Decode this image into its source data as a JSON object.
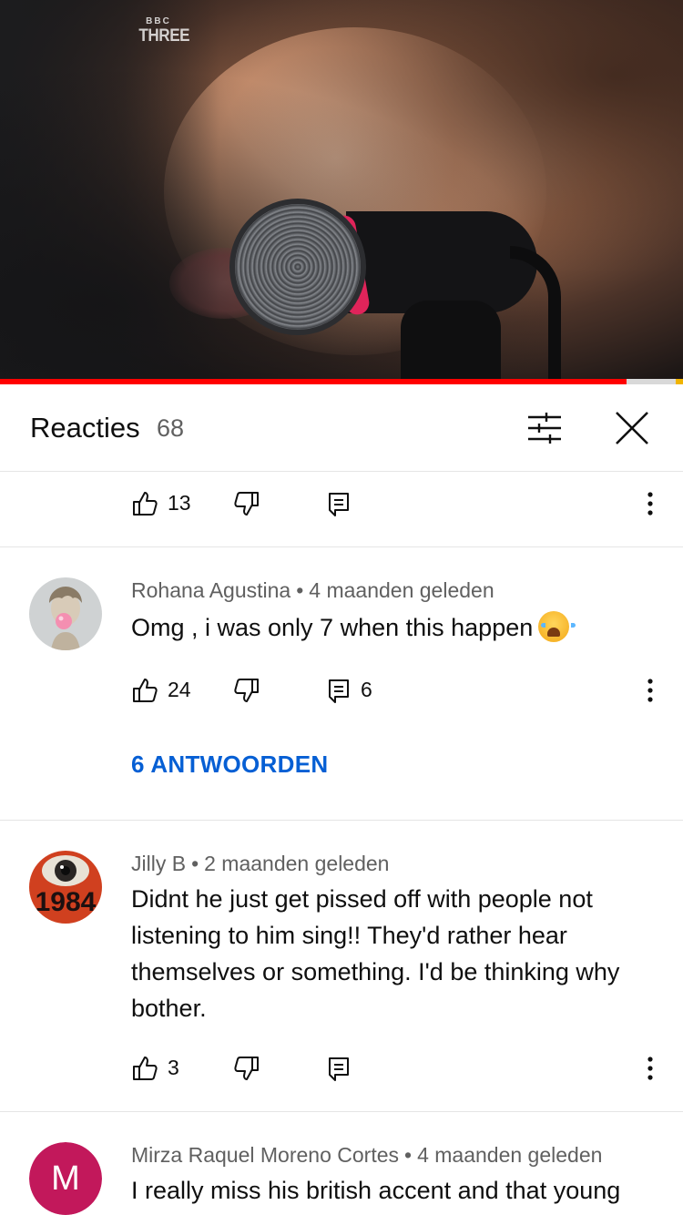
{
  "video": {
    "channel_logo_top": "BBC",
    "channel_logo_bottom": "THREE",
    "progress": 0.917,
    "colors": {
      "progress": "#ff0000",
      "progress_end": "#f0b400"
    }
  },
  "panel": {
    "title": "Reacties",
    "count": "68",
    "sort_icon": "sliders-icon",
    "close_icon": "close-icon"
  },
  "partial_comment": {
    "likes": "13",
    "replies": ""
  },
  "comments": [
    {
      "author": "Rohana Agustina",
      "age": "4 maanden geleden",
      "text": "Omg , i was only 7 when this happen",
      "emoji": "loudly-crying-face",
      "likes": "24",
      "reply_count": "6",
      "replies_link": "6 ANTWOORDEN",
      "avatar": "statue-bubblegum-avatar"
    },
    {
      "author": "Jilly B",
      "age": "2 maanden geleden",
      "text": "Didnt he just get pissed off with people not listening to him sing!!  They'd rather hear themselves or something.  I'd be thinking why bother.",
      "likes": "3",
      "reply_count": "",
      "avatar": "1984-eye-avatar",
      "avatar_text": "1984"
    },
    {
      "author": "Mirza Raquel Moreno Cortes",
      "age": "4 maanden geleden",
      "text": "I really miss his british accent and that young",
      "avatar_letter": "M",
      "avatar_color": "#c2185b"
    }
  ],
  "separator": "•",
  "link_color": "#065fd4"
}
